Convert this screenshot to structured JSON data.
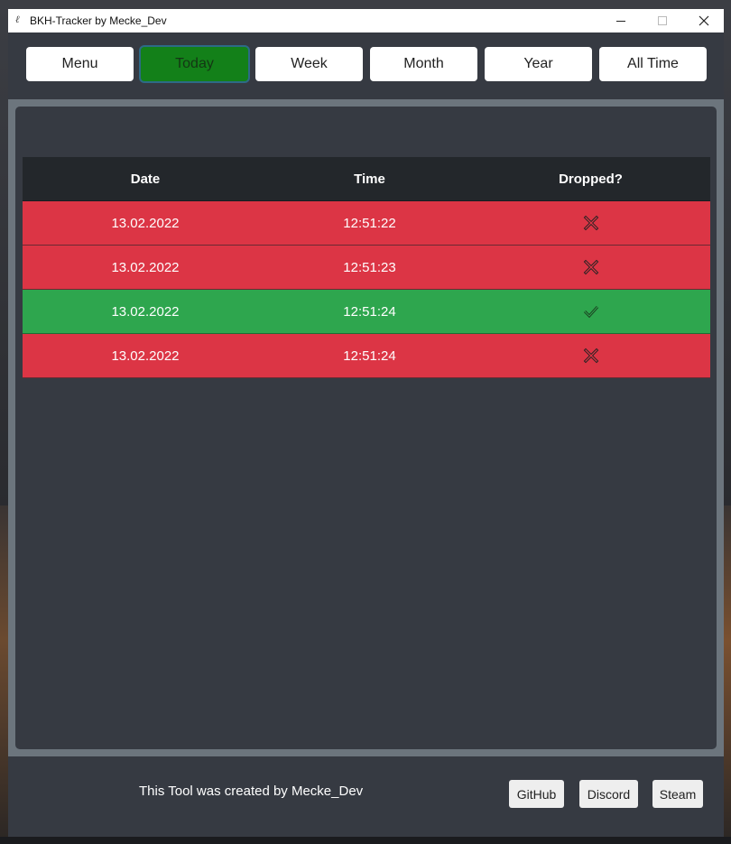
{
  "window": {
    "title": "BKH-Tracker by Mecke_Dev",
    "icon": "feather-icon"
  },
  "nav": {
    "buttons": [
      "Menu",
      "Today",
      "Week",
      "Month",
      "Year",
      "All Time"
    ],
    "active": "Today"
  },
  "table": {
    "headers": [
      "Date",
      "Time",
      "Dropped?"
    ],
    "rows": [
      {
        "date": "13.02.2022",
        "time": "12:51:22",
        "dropped": false
      },
      {
        "date": "13.02.2022",
        "time": "12:51:23",
        "dropped": false
      },
      {
        "date": "13.02.2022",
        "time": "12:51:24",
        "dropped": true
      },
      {
        "date": "13.02.2022",
        "time": "12:51:24",
        "dropped": false
      }
    ]
  },
  "footer": {
    "credit": "This Tool was created by Mecke_Dev",
    "links": [
      "GitHub",
      "Discord",
      "Steam"
    ]
  },
  "colors": {
    "active_tab": "#138019",
    "not_dropped_row": "#dc3545",
    "dropped_row": "#2ea64e",
    "header_row": "#23272b",
    "background": "#363a42"
  }
}
